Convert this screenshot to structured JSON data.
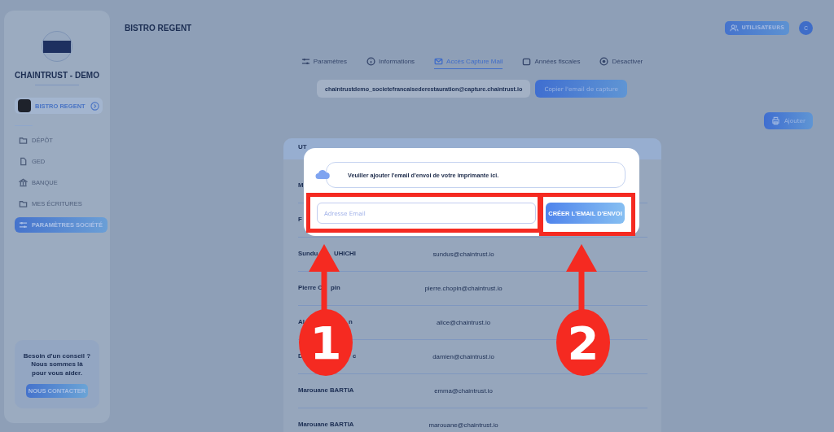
{
  "header": {
    "title": "BISTRO REGENT",
    "users_button": "UTILISATEURS",
    "avatar": "C"
  },
  "sidebar": {
    "org_name": "CHAINTRUST - DEMO",
    "company": {
      "name": "BISTRO REGENT"
    },
    "items": [
      {
        "label": "DÉPÔT",
        "selected": false
      },
      {
        "label": "GED",
        "selected": false
      },
      {
        "label": "BANQUE",
        "selected": false
      },
      {
        "label": "MES ÉCRITURES",
        "selected": false
      },
      {
        "label": "PARAMÈTRES SOCIÉTÉ",
        "selected": true
      }
    ],
    "help": {
      "text": "Besoin d'un conseil ?\nNous sommes là\npour vous aider.",
      "button": "NOUS CONTACTER"
    }
  },
  "tabs": [
    {
      "label": "Paramètres",
      "selected": false
    },
    {
      "label": "Informations",
      "selected": false
    },
    {
      "label": "Accès Capture Mail",
      "selected": true
    },
    {
      "label": "Années fiscales",
      "selected": false
    },
    {
      "label": "Désactiver",
      "selected": false
    }
  ],
  "capture": {
    "email": "chaintrustdemo_societefrancaisederestauration@capture.chaintrust.io",
    "copy_button": "Copier l'email de capture"
  },
  "add_button": "Ajouter",
  "table": {
    "columns": [
      "UT"
    ],
    "rows": [
      {
        "name_parts": [
          "M"
        ]
      },
      {
        "name_parts": [
          "F"
        ]
      },
      {
        "name_parts": [
          "Sundu",
          "UHICHI"
        ],
        "email": "sundus@chaintrust.io"
      },
      {
        "name_parts": [
          "Pierre C",
          "pin"
        ],
        "email": "pierre.chopin@chaintrust.io"
      },
      {
        "name_parts": [
          "Al",
          "n"
        ],
        "email": "alice@chaintrust.io"
      },
      {
        "name_parts": [
          "D",
          "c"
        ],
        "email": "damien@chaintrust.io"
      },
      {
        "name_parts": [
          "Marouane BARTIA"
        ],
        "email": "emma@chaintrust.io"
      },
      {
        "name_parts": [
          "Marouane BARTIA"
        ],
        "email": "marouane@chaintrust.io"
      }
    ]
  },
  "modal": {
    "message": "Veuiller ajouter l'email d'envoi de votre imprimante ici.",
    "email_field": {
      "placeholder": "Adresse Email"
    },
    "create_button": "CRÉER L'EMAIL D'ENVOI"
  },
  "annotations": [
    {
      "label": "1"
    },
    {
      "label": "2"
    }
  ]
}
